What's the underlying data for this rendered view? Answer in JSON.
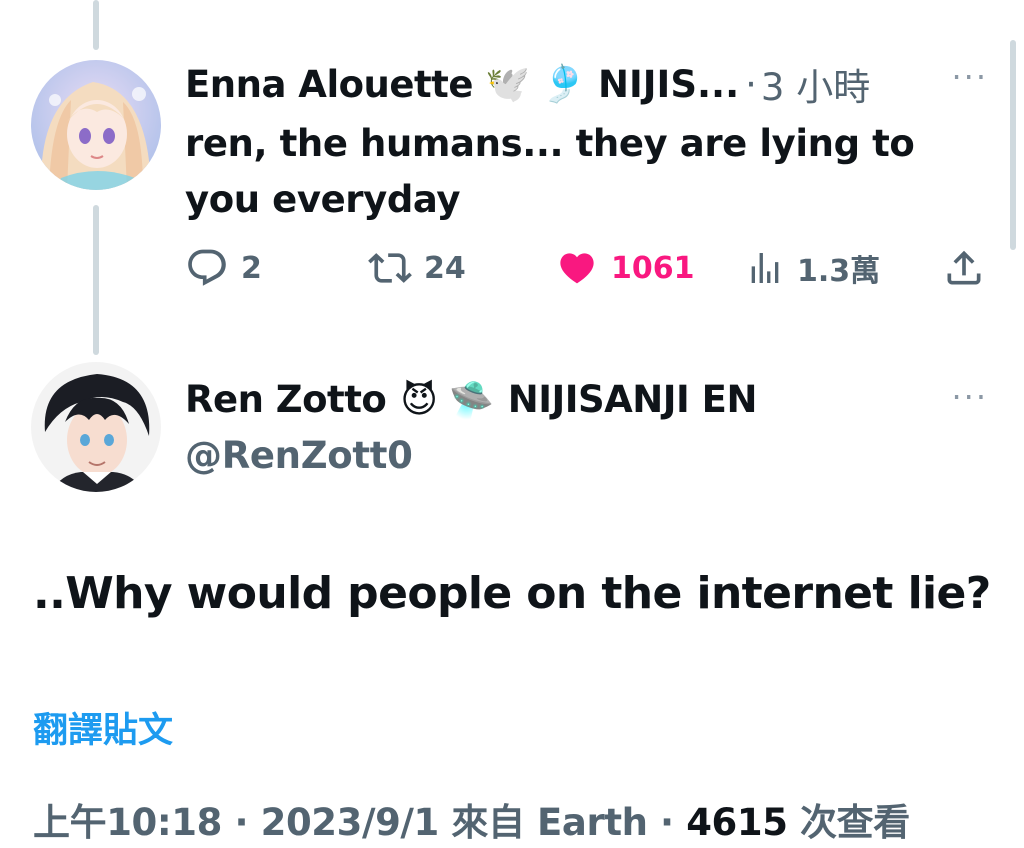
{
  "reply": {
    "author_name": "Enna Alouette",
    "author_emojis": "🕊️ 🎐",
    "author_org": "NIJIS...",
    "separator": "·",
    "time": "3 小時",
    "text": "ren, the humans... they are lying to you everyday",
    "more_label": "···",
    "stats": {
      "replies": "2",
      "retweets": "24",
      "likes": "1061",
      "views": "1.3萬"
    }
  },
  "main": {
    "author_name": "Ren Zotto",
    "author_emojis": "😈 🛸",
    "author_org": "NIJISANJI EN",
    "handle": "@RenZott0",
    "more_label": "···",
    "text": "..Why would people on the internet lie?",
    "translate": "翻譯貼文",
    "meta_prefix": "上午10:18 · 2023/9/1 來自 Earth · ",
    "meta_views_count": "4615",
    "meta_views_suffix": " 次查看"
  },
  "colors": {
    "accent": "#1d9bf0",
    "like": "#f91880",
    "muted": "#536471",
    "text": "#0f1419"
  },
  "icons": [
    "reply-icon",
    "retweet-icon",
    "heart-icon",
    "views-icon",
    "share-icon",
    "more-icon"
  ]
}
